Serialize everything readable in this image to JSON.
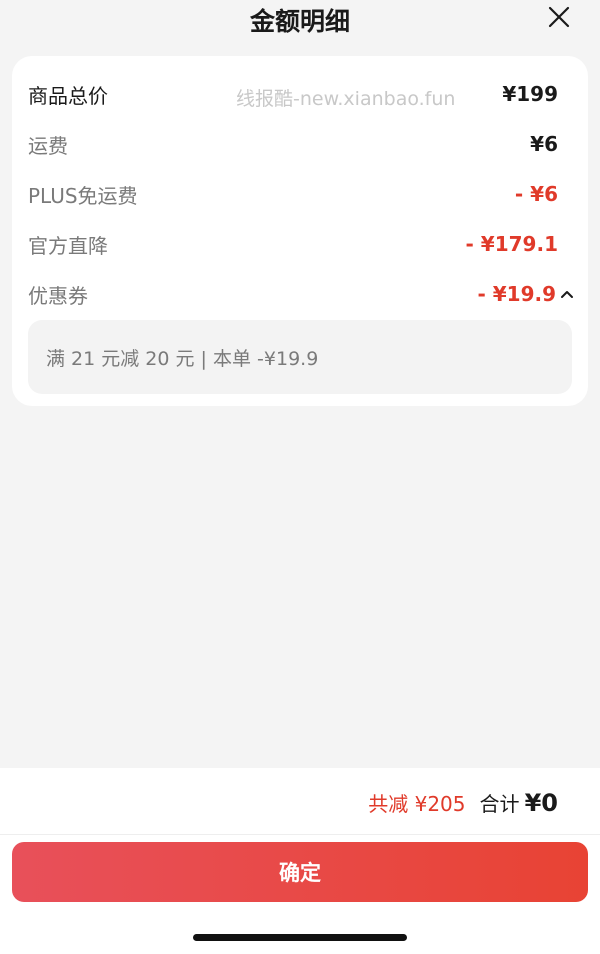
{
  "header": {
    "title": "金额明细",
    "close_icon": "close-icon"
  },
  "breakdown": {
    "items": [
      {
        "label": "商品总价",
        "amount": "¥199"
      },
      {
        "label": "运费",
        "amount": "¥6"
      },
      {
        "label": "PLUS免运费",
        "amount": "- ¥6"
      },
      {
        "label": "官方直降",
        "amount": "- ¥179.1"
      },
      {
        "label": "优惠券",
        "amount": "- ¥19.9"
      }
    ],
    "coupon_expand_icon": "chevron-up-icon",
    "coupon_detail": "满 21 元减 20 元 | 本单 -¥19.9"
  },
  "watermark": "线报酷-new.xianbao.fun",
  "footer": {
    "saved_text": "共减 ¥205",
    "total_label": "合计",
    "total_amount": "¥0",
    "confirm_label": "确定"
  },
  "colors": {
    "accent_red": "#e03a2a",
    "button_gradient_start": "#e8505a",
    "button_gradient_end": "#e84334",
    "background": "#f4f4f4"
  }
}
